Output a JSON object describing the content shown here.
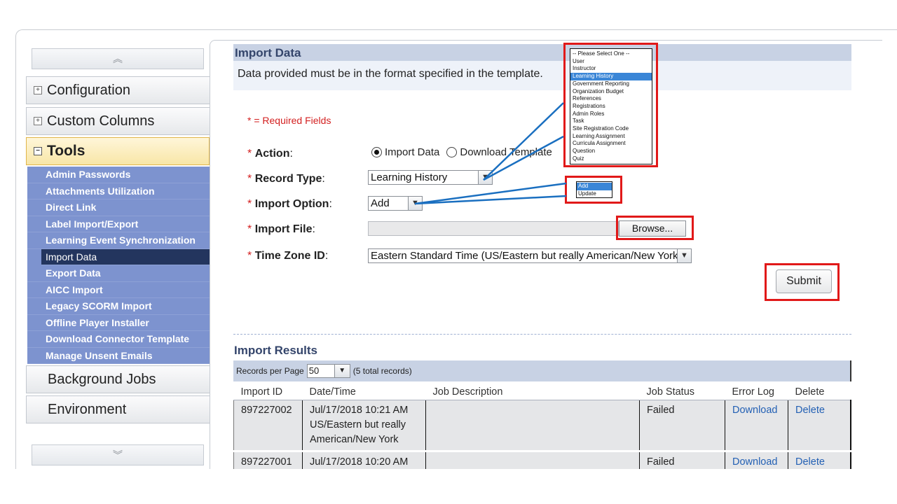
{
  "sidebar": {
    "scroll_up_icon": "︽",
    "scroll_down_icon": "︾",
    "sections": {
      "configuration": "Configuration",
      "custom_columns": "Custom Columns",
      "tools": "Tools",
      "background_jobs": "Background Jobs",
      "environment": "Environment"
    },
    "tools_items": [
      "Admin Passwords",
      "Attachments Utilization",
      "Direct Link",
      "Label Import/Export",
      "Learning Event Synchronization",
      "Import Data",
      "Export Data",
      "AICC Import",
      "Legacy SCORM Import",
      "Offline Player Installer",
      "Download Connector Template",
      "Manage Unsent Emails"
    ],
    "active_item": "Import Data"
  },
  "page": {
    "title": "Import Data",
    "format_note": "Data provided must be in the format specified in the template."
  },
  "form": {
    "required_note": "* = Required Fields",
    "asterisk": "*",
    "action_label": "Action",
    "action_options": [
      "Import Data",
      "Download Template"
    ],
    "action_selected": "Import Data",
    "record_type_label": "Record Type",
    "record_type_value": "Learning History",
    "record_type_options": [
      "-- Please Select One --",
      "User",
      "Instructor",
      "Learning History",
      "Government Reporting",
      "Organization Budget",
      "References",
      "Registrations",
      "Admin Roles",
      "Task",
      "Site Registration Code",
      "Learning Assignment",
      "Curricula Assignment",
      "Question",
      "Quiz"
    ],
    "import_option_label": "Import Option",
    "import_option_value": "Add",
    "import_option_options": [
      "Add",
      "Update"
    ],
    "import_file_label": "Import File",
    "browse_label": "Browse...",
    "time_zone_label": "Time Zone ID",
    "time_zone_value": "Eastern Standard Time (US/Eastern but really American/New York)",
    "submit_label": "Submit",
    "colon": ":"
  },
  "results": {
    "title": "Import Results",
    "records_per_page_label": "Records per Page",
    "records_per_page_value": "50",
    "total_records": "(5 total records)",
    "columns": [
      "Import ID",
      "Date/Time",
      "Job Description",
      "Job Status",
      "Error Log",
      "Delete"
    ],
    "rows": [
      {
        "import_id": "897227002",
        "date_time_1": "Jul/17/2018 10:21 AM",
        "date_time_2": "US/Eastern but really",
        "date_time_3": "American/New York",
        "job_description": "",
        "job_status": "Failed",
        "error_log": "Download",
        "delete": "Delete"
      },
      {
        "import_id": "897227001",
        "date_time_1": "Jul/17/2018 10:20 AM",
        "job_description": "",
        "job_status": "Failed",
        "error_log": "Download",
        "delete": "Delete"
      }
    ]
  },
  "colors": {
    "highlight": "#e11919",
    "callout_line": "#1a6fc0",
    "tools_menu": "#7d93cf",
    "active_item": "#23355e",
    "header_bar": "#c8d2e4",
    "link": "#2360b4"
  }
}
